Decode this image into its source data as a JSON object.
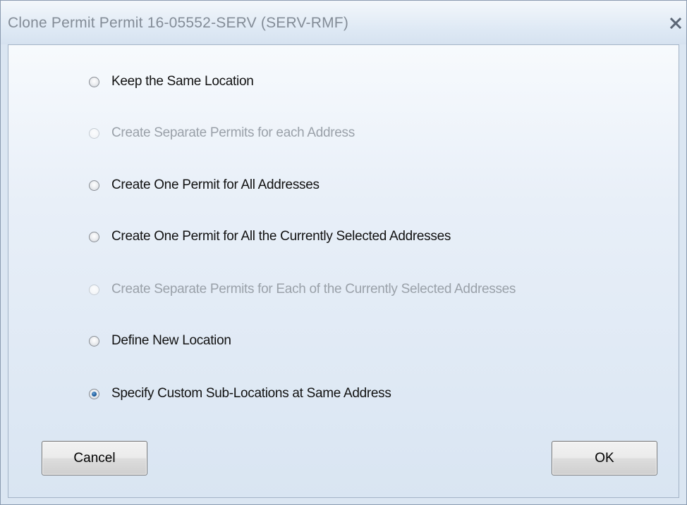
{
  "dialog": {
    "title": "Clone Permit Permit 16-05552-SERV (SERV-RMF)",
    "close_icon": "close-x-icon"
  },
  "options": [
    {
      "label": "Keep the Same Location",
      "enabled": true,
      "selected": false
    },
    {
      "label": "Create Separate Permits for each Address",
      "enabled": false,
      "selected": false
    },
    {
      "label": "Create One Permit for All Addresses",
      "enabled": true,
      "selected": false
    },
    {
      "label": "Create One Permit for All the Currently Selected Addresses",
      "enabled": true,
      "selected": false
    },
    {
      "label": "Create Separate Permits for Each of the Currently Selected Addresses",
      "enabled": false,
      "selected": false
    },
    {
      "label": "Define New Location",
      "enabled": true,
      "selected": false
    },
    {
      "label": "Specify Custom Sub-Locations at Same Address",
      "enabled": true,
      "selected": true
    }
  ],
  "buttons": {
    "cancel_label": "Cancel",
    "ok_label": "OK"
  },
  "colors": {
    "disabled_text": "#9aa1a9",
    "radio_selected": "#1b5b9a",
    "title_text": "#838c97"
  }
}
